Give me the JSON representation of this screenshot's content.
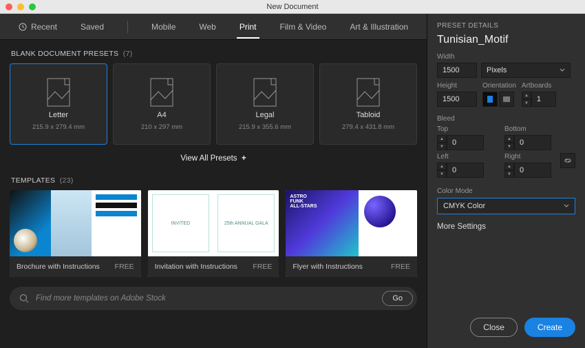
{
  "window": {
    "title": "New Document"
  },
  "tabs": {
    "recent": "Recent",
    "saved": "Saved",
    "mobile": "Mobile",
    "web": "Web",
    "print": "Print",
    "filmvideo": "Film & Video",
    "artillus": "Art & Illustration",
    "active": "print"
  },
  "presets": {
    "heading": "BLANK DOCUMENT PRESETS",
    "count": "(7)",
    "items": [
      {
        "name": "Letter",
        "dim": "215.9 x 279.4 mm",
        "selected": true
      },
      {
        "name": "A4",
        "dim": "210 x 297 mm",
        "selected": false
      },
      {
        "name": "Legal",
        "dim": "215.9 x 355.6 mm",
        "selected": false
      },
      {
        "name": "Tabloid",
        "dim": "279.4 x 431.8 mm",
        "selected": false
      }
    ],
    "viewall": "View All Presets",
    "plus": "+"
  },
  "templates": {
    "heading": "TEMPLATES",
    "count": "(23)",
    "items": [
      {
        "name": "Brochure with Instructions",
        "price": "FREE"
      },
      {
        "name": "Invitation with Instructions",
        "price": "FREE"
      },
      {
        "name": "Flyer with Instructions",
        "price": "FREE"
      }
    ],
    "thumb_text": {
      "invited": "INVITED",
      "gala": "25th ANNUAL GALA",
      "astro": "ASTRO\nFUNK\nALL-STARS"
    }
  },
  "search": {
    "placeholder": "Find more templates on Adobe Stock",
    "go": "Go"
  },
  "details": {
    "heading": "PRESET DETAILS",
    "docname": "Tunisian_Motif",
    "width_label": "Width",
    "width_value": "1500",
    "units": "Pixels",
    "height_label": "Height",
    "height_value": "1500",
    "orientation_label": "Orientation",
    "artboards_label": "Artboards",
    "artboards_value": "1",
    "bleed_label": "Bleed",
    "top_label": "Top",
    "bottom_label": "Bottom",
    "left_label": "Left",
    "right_label": "Right",
    "top": "0",
    "bottom": "0",
    "left": "0",
    "right": "0",
    "colormode_label": "Color Mode",
    "colormode_value": "CMYK Color",
    "moresettings": "More Settings"
  },
  "buttons": {
    "close": "Close",
    "create": "Create"
  }
}
